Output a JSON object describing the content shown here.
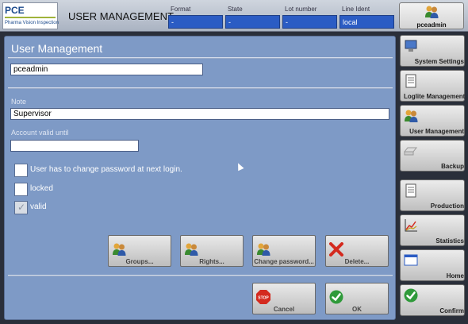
{
  "header": {
    "logo_main": "PCE",
    "logo_sub": "Pharma Vision Inspection",
    "title": "USER MANAGEMENT",
    "fields": [
      {
        "label": "Format",
        "value": "-"
      },
      {
        "label": "State",
        "value": "-"
      },
      {
        "label": "Lot number",
        "value": "-"
      },
      {
        "label": "Line Ident",
        "value": "local"
      }
    ],
    "user_button": {
      "label": "pceadmin",
      "icon": "users-icon"
    }
  },
  "panel": {
    "title": "User Management",
    "username": "pceadmin",
    "note_label": "Note",
    "note_value": "Supervisor",
    "valid_until_label": "Account valid until",
    "valid_until_value": "",
    "checkboxes": [
      {
        "label": "User has to change password at next login.",
        "checked": false
      },
      {
        "label": "locked",
        "checked": false
      },
      {
        "label": "valid",
        "checked": true
      }
    ],
    "actions": [
      {
        "label": "Groups...",
        "icon": "users-icon"
      },
      {
        "label": "Rights...",
        "icon": "users-icon"
      },
      {
        "label": "Change password...",
        "icon": "users-icon"
      },
      {
        "label": "Delete...",
        "icon": "delete-x-icon"
      }
    ],
    "cancel_label": "Cancel",
    "ok_label": "OK"
  },
  "sidebar": [
    {
      "label": "System Settings",
      "icon": "computer-icon"
    },
    {
      "label": "Loglite Management",
      "icon": "document-icon"
    },
    {
      "label": "User Management",
      "icon": "users-icon"
    },
    {
      "label": "Backup",
      "icon": "drive-icon"
    },
    {
      "label": "Production",
      "icon": "document-icon"
    },
    {
      "label": "Statistics",
      "icon": "chart-icon"
    },
    {
      "label": "Home",
      "icon": "window-icon"
    },
    {
      "label": "Confirm",
      "icon": "check-icon"
    }
  ],
  "colors": {
    "panel_bg": "#7e9ac6",
    "field_blue": "#2b5cc4"
  }
}
